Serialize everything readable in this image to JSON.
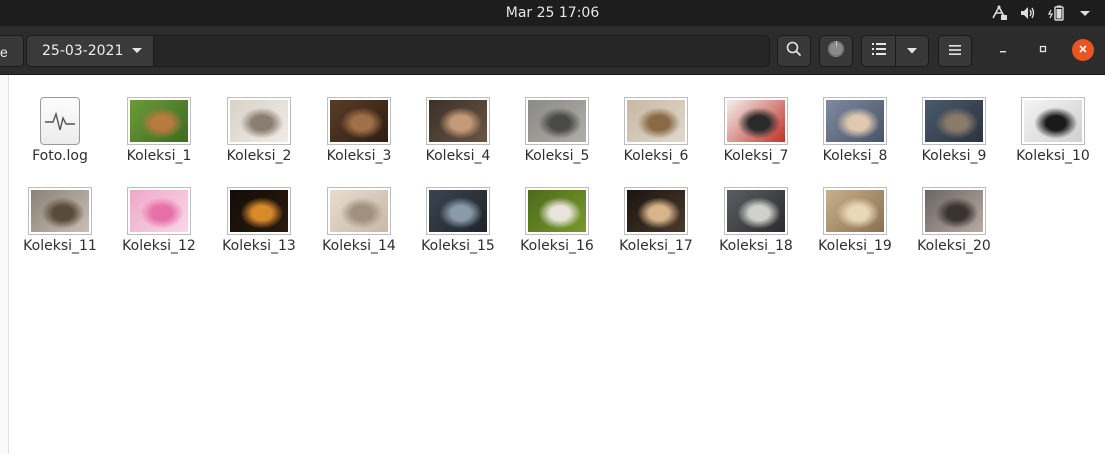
{
  "topbar": {
    "clock": "Mar 25  17:06",
    "icons": [
      "network-icon",
      "volume-icon",
      "battery-icon",
      "system-menu-icon"
    ]
  },
  "header": {
    "partial_crumb": "e",
    "current_folder": "25-03-2021",
    "buttons": [
      "search-icon",
      "disk-usage-icon",
      "list-view-icon",
      "view-options-icon",
      "menu-icon",
      "minimize-icon",
      "maximize-icon",
      "close-icon"
    ]
  },
  "files": [
    {
      "name": "Foto.log",
      "kind": "log",
      "colors": [
        "#eeeeee",
        "#dddddd"
      ]
    },
    {
      "name": "Koleksi_1",
      "kind": "image",
      "colors": [
        "#6b9a3a",
        "#b87a3e",
        "#3d6b22"
      ]
    },
    {
      "name": "Koleksi_2",
      "kind": "image",
      "colors": [
        "#d8d2c8",
        "#8a7e70",
        "#f0ece6"
      ]
    },
    {
      "name": "Koleksi_3",
      "kind": "image",
      "colors": [
        "#5a3c26",
        "#a07048",
        "#2e1e12"
      ]
    },
    {
      "name": "Koleksi_4",
      "kind": "image",
      "colors": [
        "#3b3028",
        "#c49a78",
        "#6a5444"
      ]
    },
    {
      "name": "Koleksi_5",
      "kind": "image",
      "colors": [
        "#8a8a86",
        "#4a4a48",
        "#b0aea8"
      ]
    },
    {
      "name": "Koleksi_6",
      "kind": "image",
      "colors": [
        "#c8b8a4",
        "#8a6a44",
        "#e0d8cc"
      ]
    },
    {
      "name": "Koleksi_7",
      "kind": "image",
      "colors": [
        "#f2f0ec",
        "#2a2a2a",
        "#c0322a"
      ]
    },
    {
      "name": "Koleksi_8",
      "kind": "image",
      "colors": [
        "#7e8aa0",
        "#e0c8b0",
        "#4a5468"
      ]
    },
    {
      "name": "Koleksi_9",
      "kind": "image",
      "colors": [
        "#4a5a6a",
        "#8a7a6a",
        "#2a3440"
      ]
    },
    {
      "name": "Koleksi_10",
      "kind": "image",
      "colors": [
        "#f4f4f4",
        "#1a1a1a",
        "#d0d0d0"
      ]
    },
    {
      "name": "Koleksi_11",
      "kind": "image",
      "colors": [
        "#8a8276",
        "#5a4a3a",
        "#c8c0b4"
      ]
    },
    {
      "name": "Koleksi_12",
      "kind": "image",
      "colors": [
        "#f0a8c8",
        "#e870a8",
        "#f8d8e8"
      ]
    },
    {
      "name": "Koleksi_13",
      "kind": "image",
      "colors": [
        "#120c08",
        "#d88a2a",
        "#2a1a0e"
      ]
    },
    {
      "name": "Koleksi_14",
      "kind": "image",
      "colors": [
        "#e8dcd0",
        "#a0907e",
        "#c8b8a8"
      ]
    },
    {
      "name": "Koleksi_15",
      "kind": "image",
      "colors": [
        "#3a4450",
        "#8a9aa8",
        "#1e242a"
      ]
    },
    {
      "name": "Koleksi_16",
      "kind": "image",
      "colors": [
        "#4a6a1a",
        "#e8e4dc",
        "#7a9a2a"
      ]
    },
    {
      "name": "Koleksi_17",
      "kind": "image",
      "colors": [
        "#1a1410",
        "#d8b48a",
        "#4a3a2a"
      ]
    },
    {
      "name": "Koleksi_18",
      "kind": "image",
      "colors": [
        "#5a5e62",
        "#d0d0cc",
        "#2a2c2e"
      ]
    },
    {
      "name": "Koleksi_19",
      "kind": "image",
      "colors": [
        "#c8b08a",
        "#e8d8b8",
        "#8a7050"
      ]
    },
    {
      "name": "Koleksi_20",
      "kind": "image",
      "colors": [
        "#6a6460",
        "#3a3430",
        "#b8aca4"
      ]
    }
  ]
}
